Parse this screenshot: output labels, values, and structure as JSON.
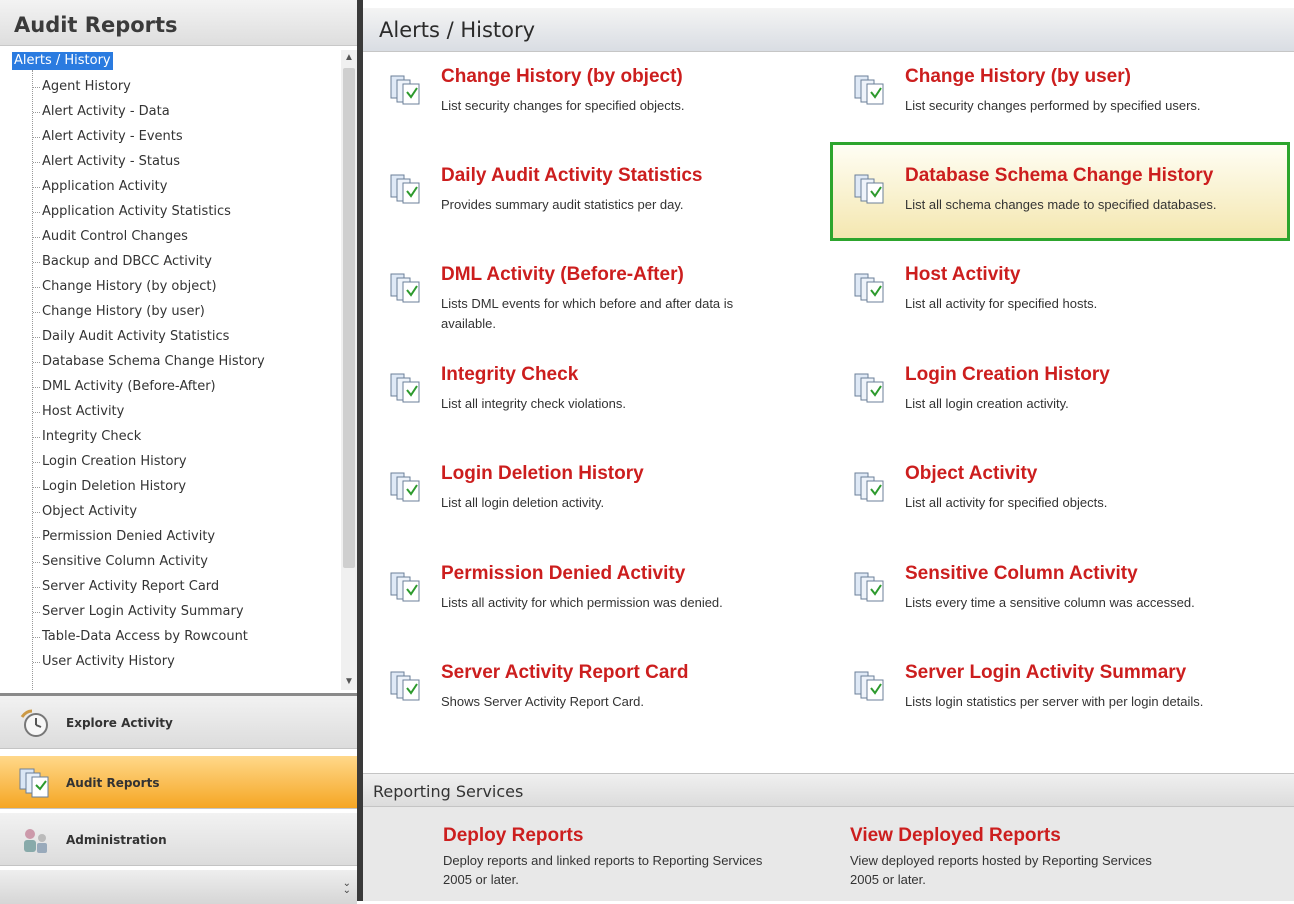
{
  "left_panel": {
    "title": "Audit Reports",
    "tree": {
      "root_label": "Alerts / History",
      "items": [
        "Agent History",
        "Alert Activity - Data",
        "Alert Activity - Events",
        "Alert Activity - Status",
        "Application Activity",
        "Application Activity Statistics",
        "Audit Control Changes",
        "Backup and DBCC Activity",
        "Change History (by object)",
        "Change History (by user)",
        "Daily Audit Activity Statistics",
        "Database Schema Change History",
        "DML Activity (Before-After)",
        "Host Activity",
        "Integrity Check",
        "Login Creation History",
        "Login Deletion History",
        "Object Activity",
        "Permission Denied Activity",
        "Sensitive Column Activity",
        "Server Activity Report Card",
        "Server Login Activity Summary",
        "Table-Data Access by Rowcount",
        "User Activity History"
      ]
    },
    "nav_buttons": [
      {
        "label": "Explore Activity",
        "icon": "clock-icon"
      },
      {
        "label": "Audit Reports",
        "icon": "reports-icon",
        "active": true
      },
      {
        "label": "Administration",
        "icon": "admin-icon"
      }
    ]
  },
  "main": {
    "title": "Alerts / History",
    "reports": [
      {
        "title": "Change History (by object)",
        "desc": "List security changes for specified objects."
      },
      {
        "title": "Change History (by user)",
        "desc": "List security changes performed by specified users."
      },
      {
        "title": "Daily Audit Activity Statistics",
        "desc": "Provides summary audit statistics per day."
      },
      {
        "title": "Database Schema Change History",
        "desc": "List all schema changes made to specified databases."
      },
      {
        "title": "DML Activity (Before-After)",
        "desc": "Lists DML events for which before and after data is available."
      },
      {
        "title": "Host Activity",
        "desc": "List all activity for specified hosts."
      },
      {
        "title": "Integrity Check",
        "desc": "List all integrity check violations."
      },
      {
        "title": "Login Creation History",
        "desc": "List all login creation activity."
      },
      {
        "title": "Login Deletion History",
        "desc": "List all login deletion activity."
      },
      {
        "title": "Object Activity",
        "desc": "List all activity for specified objects."
      },
      {
        "title": "Permission Denied Activity",
        "desc": "Lists all activity for which permission was denied."
      },
      {
        "title": "Sensitive Column Activity",
        "desc": "Lists every time a sensitive column was accessed."
      },
      {
        "title": "Server Activity Report Card",
        "desc": "Shows Server Activity Report Card."
      },
      {
        "title": "Server Login Activity Summary",
        "desc": "Lists login statistics per server with per login details."
      }
    ],
    "reporting_services": {
      "title": "Reporting Services",
      "items": [
        {
          "title": "Deploy Reports",
          "desc": "Deploy reports and linked reports to Reporting Services 2005 or later."
        },
        {
          "title": "View Deployed Reports",
          "desc": "View deployed reports hosted by Reporting Services 2005 or later."
        }
      ]
    }
  },
  "colors": {
    "link_red": "#cc1e1e",
    "selection_blue": "#2a7be0",
    "highlight_green": "#2da52d",
    "active_orange": "#f5a623"
  }
}
